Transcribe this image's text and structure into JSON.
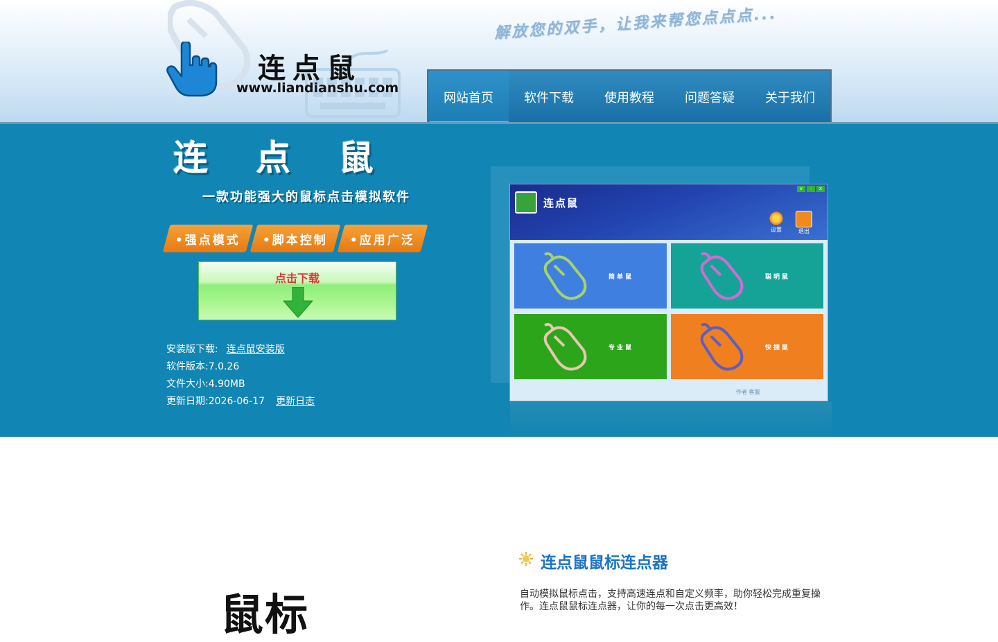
{
  "header": {
    "logo_name": "连点鼠",
    "logo_url": "www.liandianshu.com",
    "slogan": "解放您的双手，让我来帮您点点点..."
  },
  "nav": {
    "items": [
      {
        "label": "网站首页",
        "active": true
      },
      {
        "label": "软件下载",
        "active": false
      },
      {
        "label": "使用教程",
        "active": false
      },
      {
        "label": "问题答疑",
        "active": false
      },
      {
        "label": "关于我们",
        "active": false
      }
    ]
  },
  "banner": {
    "title": "连 点 鼠",
    "subtitle": "一款功能强大的鼠标点击模拟软件",
    "features": [
      "•强点模式",
      "•脚本控制",
      "•应用广泛"
    ],
    "download_label": "点击下载",
    "install_label": "安装版下载:",
    "install_link": "连点鼠安装版",
    "version": "软件版本:7.0.26",
    "size": "文件大小:4.90MB",
    "date": "更新日期:2026-06-17",
    "changelog_link": "更新日志"
  },
  "app_preview": {
    "title": "连点鼠",
    "window_controls": [
      "v",
      "–",
      "x"
    ],
    "tools": [
      {
        "label": "设置"
      },
      {
        "label": "退出"
      }
    ],
    "tiles": [
      {
        "label": "简单鼠",
        "color": "#3f7fe0"
      },
      {
        "label": "聪明鼠",
        "color": "#15a398"
      },
      {
        "label": "专业鼠",
        "color": "#2ca51a"
      },
      {
        "label": "快捷鼠",
        "color": "#f07f20"
      }
    ],
    "footer": "作者  客服"
  },
  "lower": {
    "title": "连点鼠鼠标连点器",
    "description": "自动模拟鼠标点击，支持高速连点和自定义频率，助你轻松完成重复操作。连点鼠鼠标连点器，让你的每一次点击更高效！",
    "big_text": "鼠标"
  },
  "colors": {
    "banner_bg": "#1185b3",
    "nav_bg": "#1f78ad",
    "accent_orange": "#f2a12b",
    "title_blue": "#1a73c8"
  }
}
